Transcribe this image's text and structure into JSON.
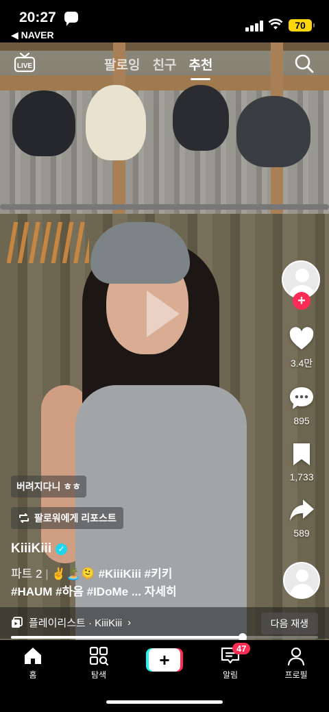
{
  "status_bar": {
    "time": "20:27",
    "back_app": "◀ NAVER",
    "battery": "70"
  },
  "top_nav": {
    "live_label": "LIVE",
    "tabs": [
      {
        "label": "팔로잉",
        "active": false
      },
      {
        "label": "친구",
        "active": false
      },
      {
        "label": "추천",
        "active": true
      }
    ]
  },
  "rail": {
    "likes": "3.4만",
    "comments": "895",
    "saves": "1,733",
    "shares": "589"
  },
  "post": {
    "chip": "버려지다니 ㅎㅎ",
    "repost": "팔로워에게 리포스트",
    "username": "KiiiKiii",
    "caption_prefix": "파트 2",
    "caption_emoji": "✌️🏝️🫠",
    "caption_tags_line1": "#KiiiKiii #키키",
    "caption_tags_line2": "#HAUM #하음  #IDoMe",
    "caption_more": "... 자세히",
    "playlist": "플레이리스트 · KiiiKiii",
    "next": "다음 재생",
    "progress": 0.755
  },
  "tabbar": {
    "home": "홈",
    "explore": "탐색",
    "inbox": "알림",
    "inbox_badge": "47",
    "profile": "프로필"
  },
  "colors": {
    "accent_red": "#fe2c55",
    "accent_cyan": "#25f4ee",
    "battery": "#ffd60a",
    "verified": "#20d5ec"
  },
  "icons": [
    "message-icon",
    "signal-icon",
    "wifi-icon",
    "live-icon",
    "search-icon",
    "play-icon",
    "heart-icon",
    "comment-icon",
    "bookmark-icon",
    "share-icon",
    "repost-icon",
    "playlist-icon",
    "home-icon",
    "explore-icon",
    "plus-icon",
    "inbox-icon",
    "profile-icon"
  ]
}
